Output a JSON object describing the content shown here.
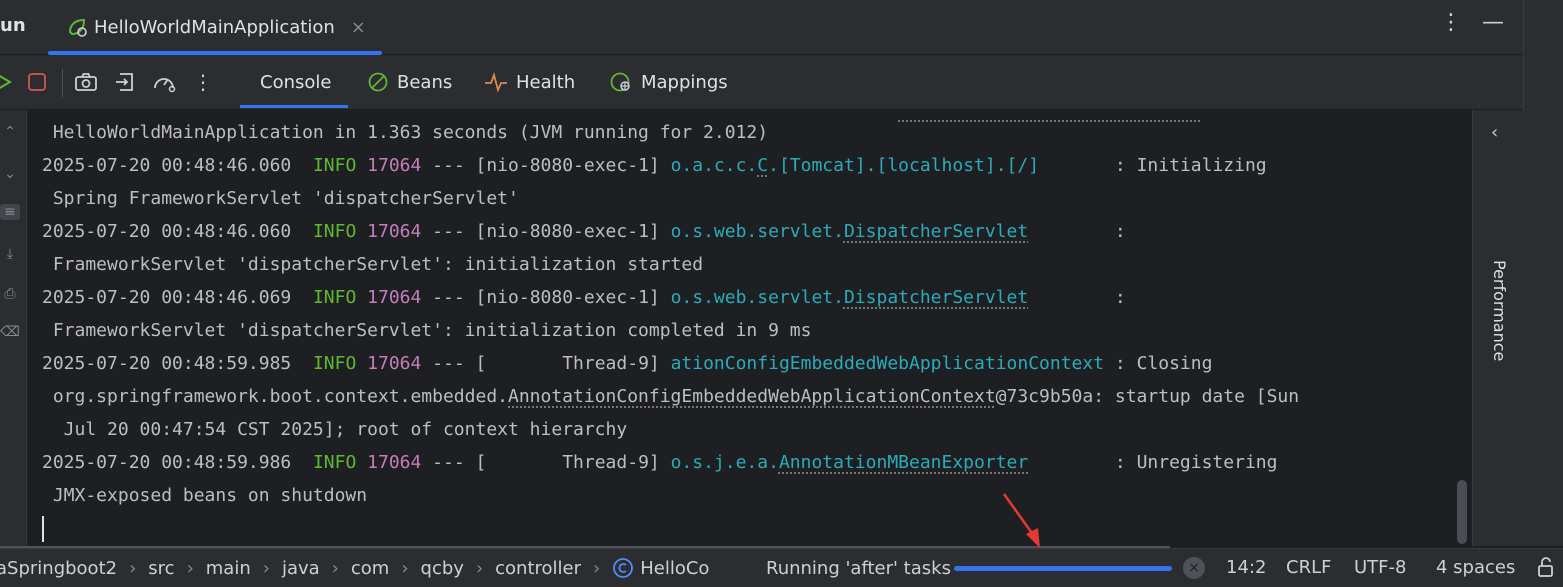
{
  "run_tool": {
    "label": "un"
  },
  "tab": {
    "title": "HelloWorldMainApplication",
    "close": "×"
  },
  "top_actions": {
    "more": "⋮",
    "minimize": "—"
  },
  "console_tabs": [
    {
      "label": "Console"
    },
    {
      "label": "Beans"
    },
    {
      "label": "Health"
    },
    {
      "label": "Mappings"
    }
  ],
  "log": {
    "l1_text": " HelloWorldMainApplication in 1.363 seconds (JVM running for 2.012)",
    "l2_ts": "2025-07-20 00:48:46.060  ",
    "l2_level": "INFO",
    "l2_pid": "17064",
    "l2_thread": " --- [nio-8080-exec-1] ",
    "l2_logger_a": "o.a.c.c.",
    "l2_logger_b": "C",
    "l2_logger_c": ".[Tomcat].[localhost].[/]",
    "l2_msg": "       : Initializing",
    "l3_text": " Spring FrameworkServlet 'dispatcherServlet'",
    "l4_ts": "2025-07-20 00:48:46.060  ",
    "l4_level": "INFO",
    "l4_pid": "17064",
    "l4_thread": " --- [nio-8080-exec-1] ",
    "l4_logger_a": "o.s.web.servlet.",
    "l4_logger_b": "DispatcherServlet",
    "l4_msg": "        :",
    "l5_text": " FrameworkServlet 'dispatcherServlet': initialization started",
    "l6_ts": "2025-07-20 00:48:46.069  ",
    "l6_level": "INFO",
    "l6_pid": "17064",
    "l6_thread": " --- [nio-8080-exec-1] ",
    "l6_logger_a": "o.s.web.servlet.",
    "l6_logger_b": "DispatcherServlet",
    "l6_msg": "        :",
    "l7_text": " FrameworkServlet 'dispatcherServlet': initialization completed in 9 ms",
    "l8_ts": "2025-07-20 00:48:59.985  ",
    "l8_level": "INFO",
    "l8_pid": "17064",
    "l8_thread": " --- [       Thread-9] ",
    "l8_logger": "ationConfigEmbeddedWebApplicationContext",
    "l8_msg": " : Closing",
    "l9_a": " org.springframework.boot.context.embedded.",
    "l9_b": "AnnotationConfigEmbeddedWebApplicationContext",
    "l9_c": "@73c9b50a: startup date [Sun",
    "l10_text": "  Jul 20 00:47:54 CST 2025]; root of context hierarchy",
    "l11_ts": "2025-07-20 00:48:59.986  ",
    "l11_level": "INFO",
    "l11_pid": "17064",
    "l11_thread": " --- [       Thread-9] ",
    "l11_logger_a": "o.s.j.e.a.",
    "l11_logger_b": "AnnotationMBeanExporter",
    "l11_msg": "        : Unregistering",
    "l12_text": " JMX-exposed beans on shutdown"
  },
  "side_panel": {
    "label": "Performance",
    "collapse": "‹"
  },
  "breadcrumb": [
    {
      "label": "aSpringboot2"
    },
    {
      "label": "src"
    },
    {
      "label": "main"
    },
    {
      "label": "java"
    },
    {
      "label": "com"
    },
    {
      "label": "qcby"
    },
    {
      "label": "controller"
    },
    {
      "label": "HelloCo"
    }
  ],
  "breadcrumb_separator": "›",
  "status": {
    "task": "Running 'after' tasks",
    "cancel": "×",
    "position": "14:2",
    "line_ending": "CRLF",
    "encoding": "UTF-8",
    "indent": "4 spaces"
  },
  "colors": {
    "accent": "#3574f0",
    "info": "#5fb832",
    "pid": "#c77dbb",
    "logger": "#2aacb8",
    "stop": "#c94f4f",
    "arrow": "#e53935"
  }
}
